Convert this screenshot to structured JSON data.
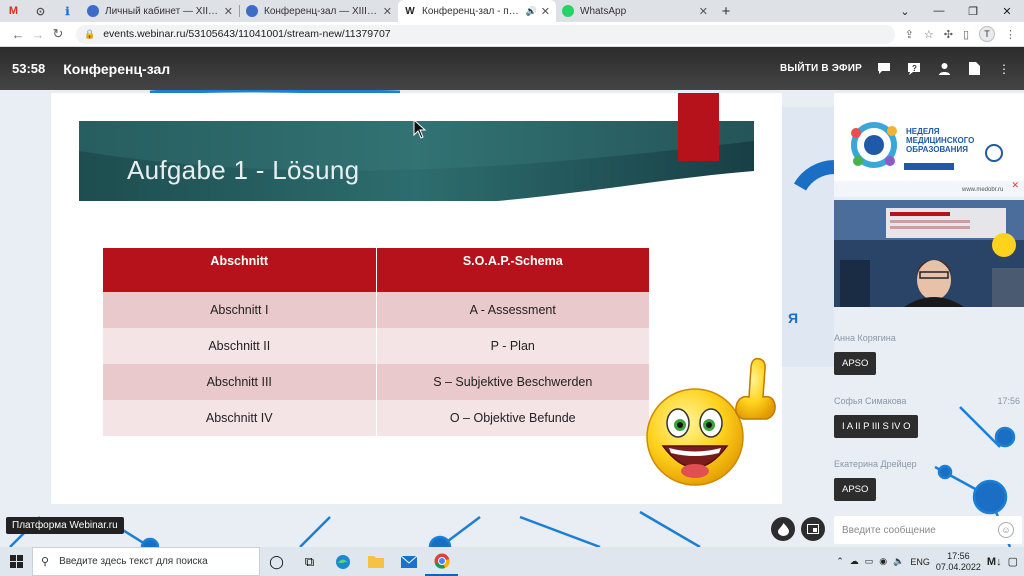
{
  "browser": {
    "pinned_tabs": [
      "M",
      "⊙",
      "ℹ"
    ],
    "tabs": [
      {
        "title": "Личный кабинет — XIII Общерос",
        "favicon_color": "#3b6cc7",
        "active": false
      },
      {
        "title": "Конференц-зал — XIII Общерос",
        "favicon_color": "#3b6cc7",
        "active": false
      },
      {
        "title": "Конференц-зал - платформа",
        "favicon_color": "#222222",
        "favicon_letter": "W",
        "audio": "🔊",
        "active": true
      },
      {
        "title": "WhatsApp",
        "favicon_color": "#25d366",
        "active": false
      }
    ],
    "new_tab": "+",
    "window_controls": [
      "⌄",
      "—",
      "❐",
      "✕"
    ],
    "url": "events.webinar.ru/53105643/11041001/stream-new/11379707",
    "profile_letter": "T"
  },
  "app": {
    "timer": "53:58",
    "room_title": "Конференц-зал",
    "exit_label": "ВЫЙТИ В ЭФИР"
  },
  "slide": {
    "title": "Aufgabe 1 - Lösung",
    "table": {
      "headers": [
        "Abschnitt",
        "S.O.A.P.-Schema"
      ],
      "rows": [
        [
          "Abschnitt I",
          "A - Assessment"
        ],
        [
          "Abschnitt II",
          "P - Plan"
        ],
        [
          "Abschnitt III",
          "S – Subjektive Beschwerden"
        ],
        [
          "Abschnitt IV",
          "O – Objektive Befunde"
        ]
      ]
    }
  },
  "camera1": {
    "line1": "НЕДЕЛЯ",
    "line2": "МЕДИЦИНСКОГО",
    "line3": "ОБРАЗОВАНИЯ",
    "dates": "4 — 8 апреля 2022 года"
  },
  "chat": {
    "messages": [
      {
        "author": "Анна Корягина",
        "time": "",
        "text": "APSO"
      },
      {
        "author": "Софья Симакова",
        "time": "17:56",
        "text": "I A II P III S IV O"
      },
      {
        "author": "Екатерина Дрейцер",
        "time": "",
        "text": "APSO"
      }
    ],
    "input_placeholder": "Введите сообщение"
  },
  "platform_badge": "Платформа Webinar.ru",
  "taskbar": {
    "search_placeholder": "Введите здесь текст для поиска",
    "lang": "ENG",
    "time": "17:56",
    "date": "07.04.2022"
  }
}
